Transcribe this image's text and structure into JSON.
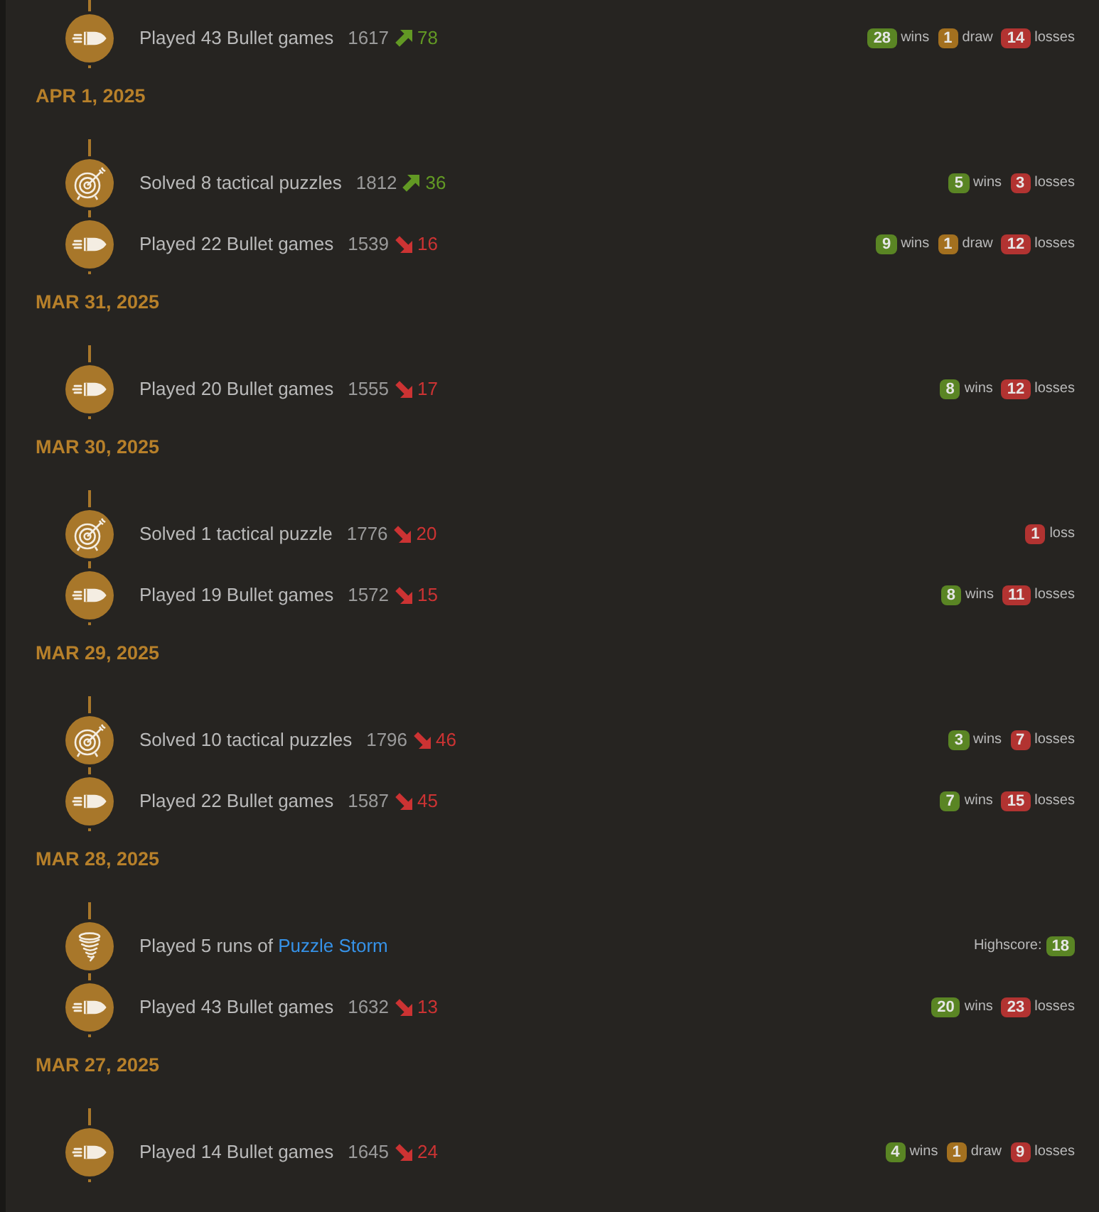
{
  "groups": [
    {
      "entries": [
        {
          "kind": "bullet",
          "text": "Played 43 Bullet games",
          "rating": "1617",
          "rising": true,
          "diff": "78",
          "results": [
            {
              "kind": "win",
              "count": "28",
              "label": "wins"
            },
            {
              "kind": "draw",
              "count": "1",
              "label": "draw"
            },
            {
              "kind": "loss",
              "count": "14",
              "label": "losses"
            }
          ]
        }
      ]
    },
    {
      "date": "APR 1, 2025",
      "entries": [
        {
          "kind": "puzzle",
          "text": "Solved 8 tactical puzzles",
          "rating": "1812",
          "rising": true,
          "diff": "36",
          "results": [
            {
              "kind": "win",
              "count": "5",
              "label": "wins"
            },
            {
              "kind": "loss",
              "count": "3",
              "label": "losses"
            }
          ]
        },
        {
          "kind": "bullet",
          "text": "Played 22 Bullet games",
          "rating": "1539",
          "rising": false,
          "diff": "16",
          "results": [
            {
              "kind": "win",
              "count": "9",
              "label": "wins"
            },
            {
              "kind": "draw",
              "count": "1",
              "label": "draw"
            },
            {
              "kind": "loss",
              "count": "12",
              "label": "losses"
            }
          ]
        }
      ]
    },
    {
      "date": "MAR 31, 2025",
      "entries": [
        {
          "kind": "bullet",
          "text": "Played 20 Bullet games",
          "rating": "1555",
          "rising": false,
          "diff": "17",
          "results": [
            {
              "kind": "win",
              "count": "8",
              "label": "wins"
            },
            {
              "kind": "loss",
              "count": "12",
              "label": "losses"
            }
          ]
        }
      ]
    },
    {
      "date": "MAR 30, 2025",
      "entries": [
        {
          "kind": "puzzle",
          "text": "Solved 1 tactical puzzle",
          "rating": "1776",
          "rising": false,
          "diff": "20",
          "results": [
            {
              "kind": "loss",
              "count": "1",
              "label": "loss"
            }
          ]
        },
        {
          "kind": "bullet",
          "text": "Played 19 Bullet games",
          "rating": "1572",
          "rising": false,
          "diff": "15",
          "results": [
            {
              "kind": "win",
              "count": "8",
              "label": "wins"
            },
            {
              "kind": "loss",
              "count": "11",
              "label": "losses"
            }
          ]
        }
      ]
    },
    {
      "date": "MAR 29, 2025",
      "entries": [
        {
          "kind": "puzzle",
          "text": "Solved 10 tactical puzzles",
          "rating": "1796",
          "rising": false,
          "diff": "46",
          "results": [
            {
              "kind": "win",
              "count": "3",
              "label": "wins"
            },
            {
              "kind": "loss",
              "count": "7",
              "label": "losses"
            }
          ]
        },
        {
          "kind": "bullet",
          "text": "Played 22 Bullet games",
          "rating": "1587",
          "rising": false,
          "diff": "45",
          "results": [
            {
              "kind": "win",
              "count": "7",
              "label": "wins"
            },
            {
              "kind": "loss",
              "count": "15",
              "label": "losses"
            }
          ]
        }
      ]
    },
    {
      "date": "MAR 28, 2025",
      "entries": [
        {
          "kind": "storm",
          "text": "Played 5 runs of",
          "link": "Puzzle Storm",
          "results": [
            {
              "kind": "highscore",
              "label": "Highscore:",
              "count": "18"
            }
          ]
        },
        {
          "kind": "bullet",
          "text": "Played 43 Bullet games",
          "rating": "1632",
          "rising": false,
          "diff": "13",
          "results": [
            {
              "kind": "win",
              "count": "20",
              "label": "wins"
            },
            {
              "kind": "loss",
              "count": "23",
              "label": "losses"
            }
          ]
        }
      ]
    },
    {
      "date": "MAR 27, 2025",
      "entries": [
        {
          "kind": "bullet",
          "text": "Played 14 Bullet games",
          "rating": "1645",
          "rising": false,
          "diff": "24",
          "results": [
            {
              "kind": "win",
              "count": "4",
              "label": "wins"
            },
            {
              "kind": "draw",
              "count": "1",
              "label": "draw"
            },
            {
              "kind": "loss",
              "count": "9",
              "label": "losses"
            }
          ]
        }
      ]
    }
  ]
}
